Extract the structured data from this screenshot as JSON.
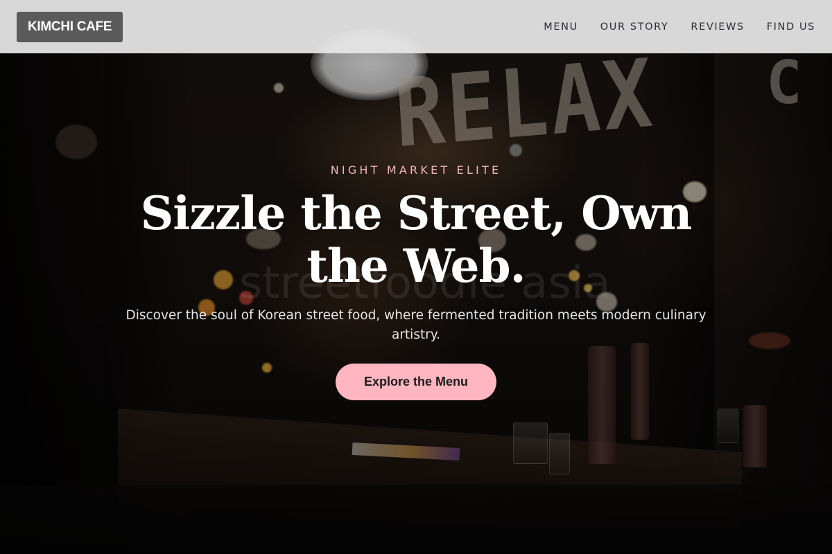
{
  "brand": {
    "logo_text": "KIMCHI CAFE"
  },
  "nav": {
    "items": [
      {
        "label": "MENU"
      },
      {
        "label": "OUR STORY"
      },
      {
        "label": "REVIEWS"
      },
      {
        "label": "FIND US"
      }
    ]
  },
  "hero": {
    "eyebrow": "NIGHT MARKET ELITE",
    "headline": "Sizzle the Street, Own the Web.",
    "subtitle": "Discover the soul of Korean street food, where fermented tradition meets modern culinary artistry.",
    "cta_label": "Explore the Menu",
    "background_sign_text": "RELAX",
    "background_watermark": "streetfoodie asia"
  },
  "colors": {
    "navbar_bg": "#e6e6e6",
    "logo_bg": "#5a5a5a",
    "accent_pink": "#ffb6c1",
    "eyebrow_pink": "#f2b6bf",
    "nav_text": "#2a2e35"
  }
}
